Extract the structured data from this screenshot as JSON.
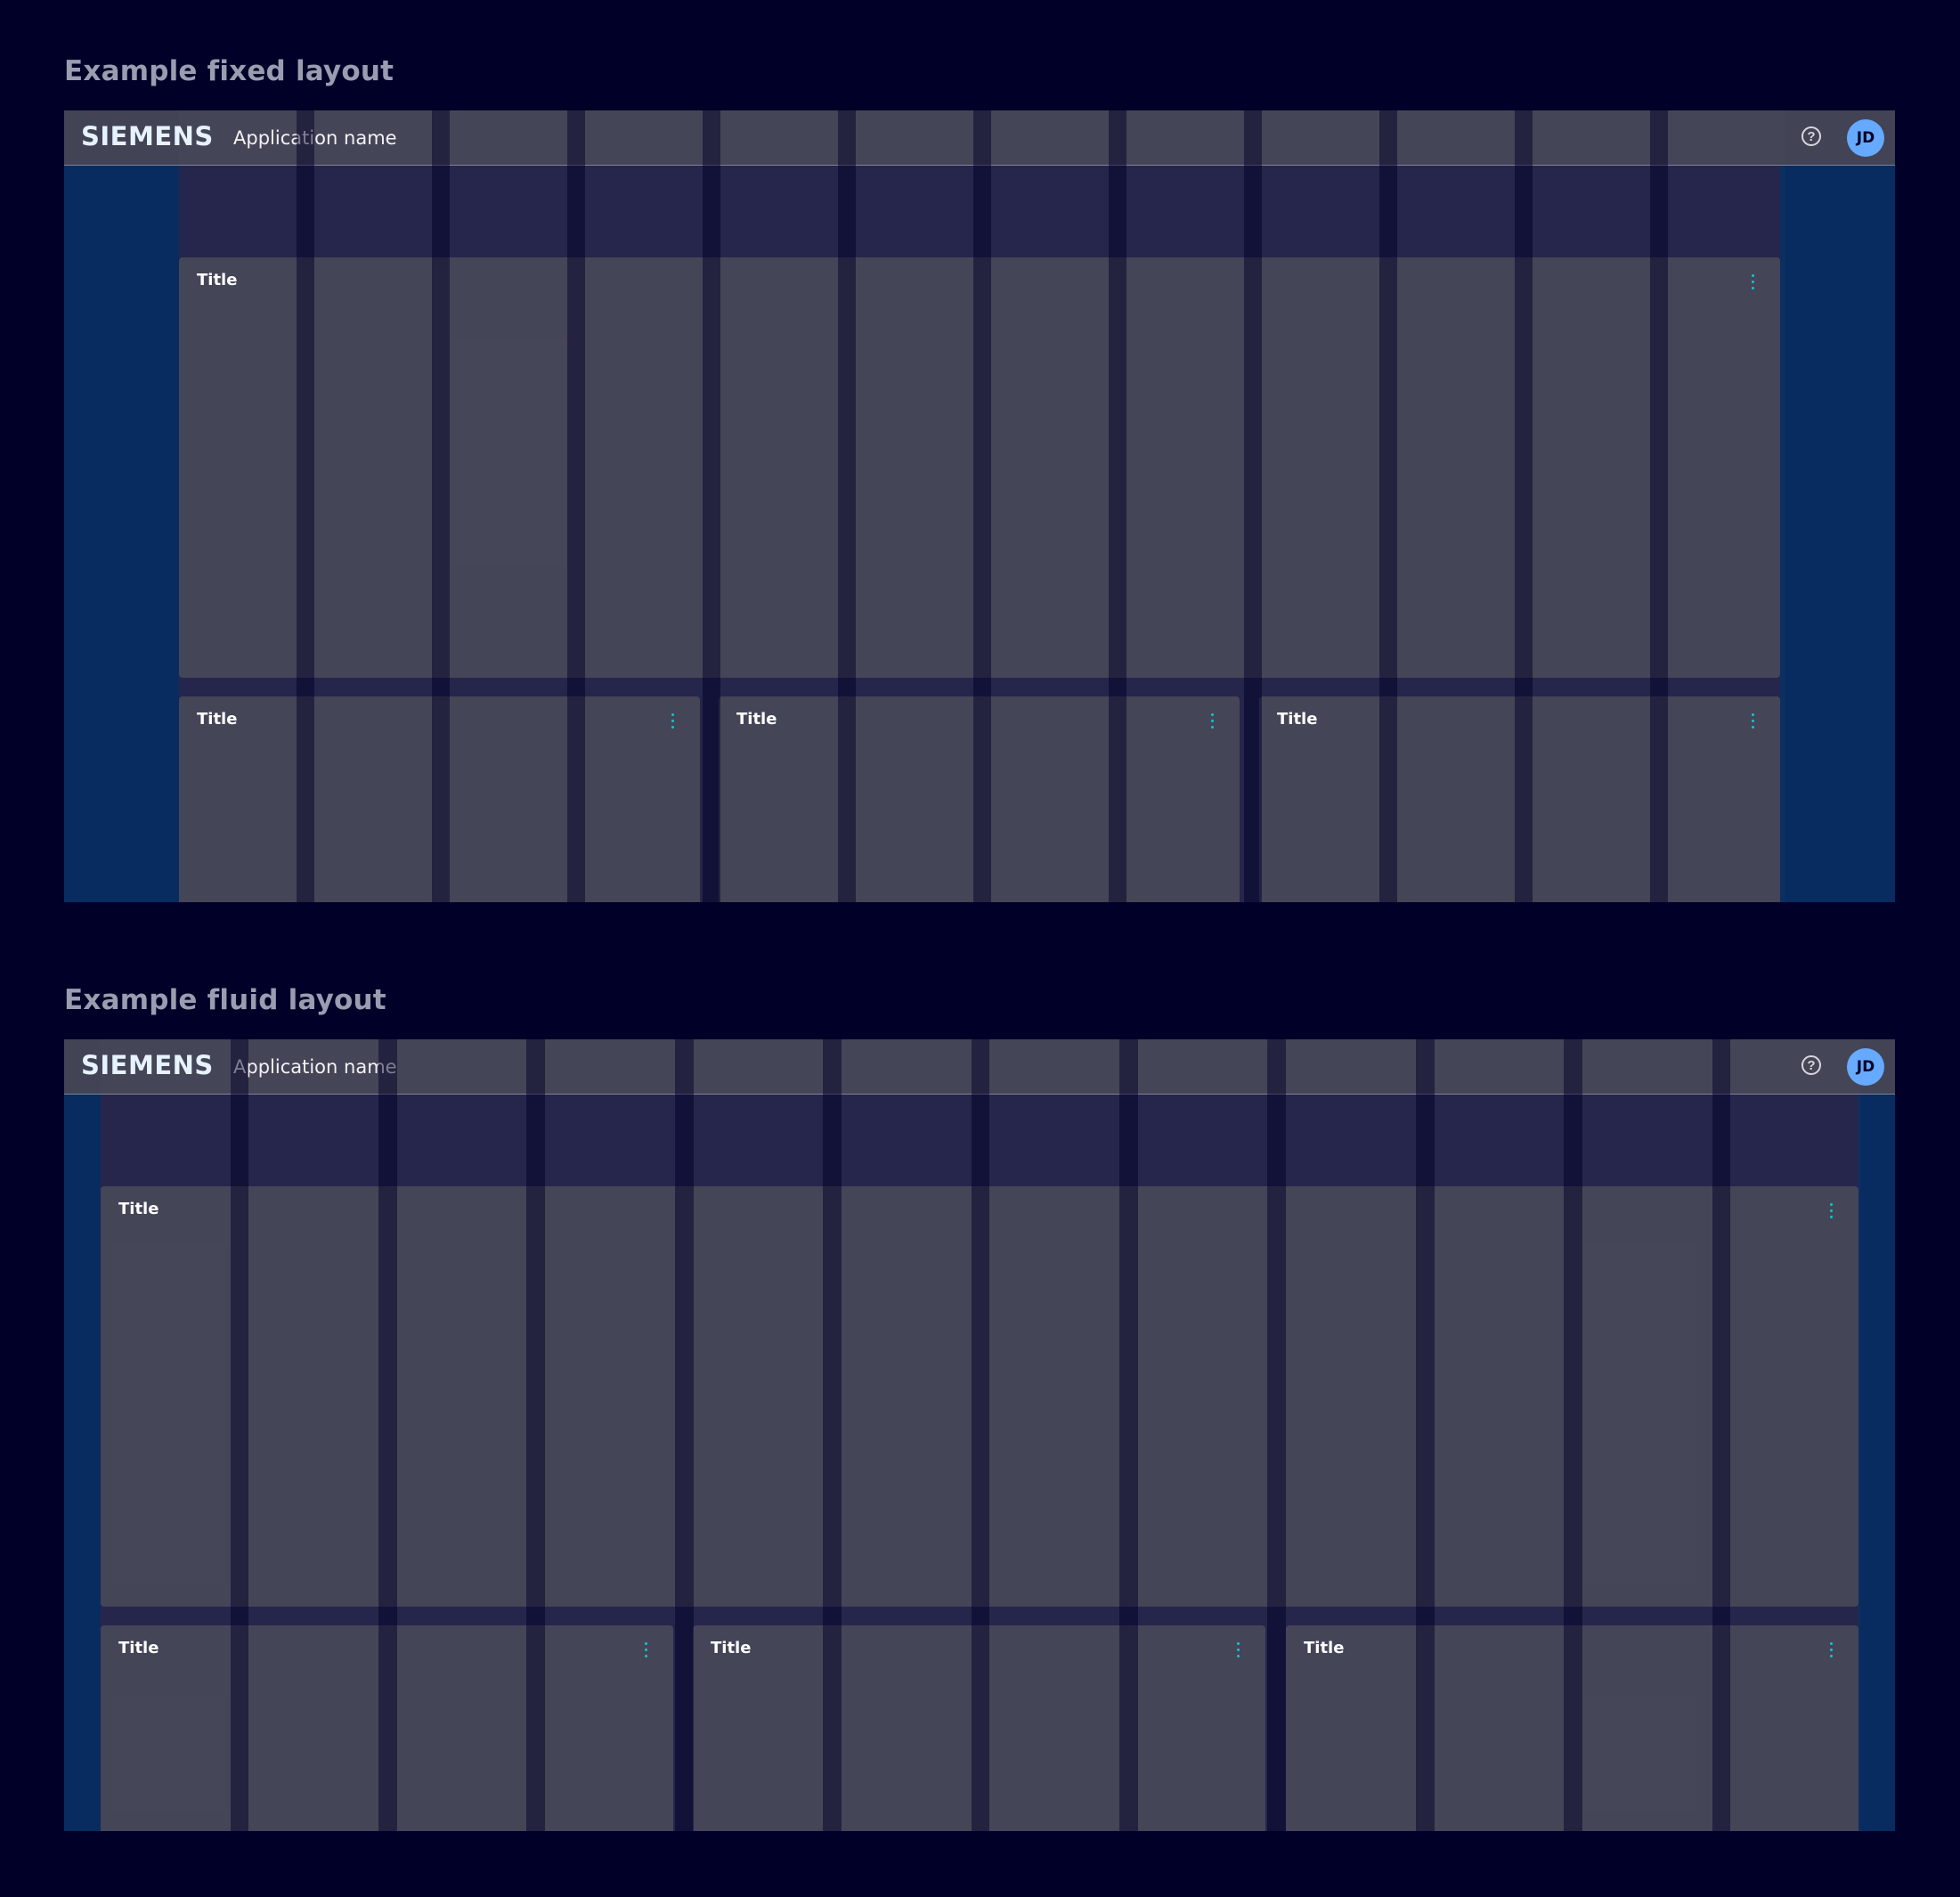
{
  "fixed": {
    "section_title": "Example fixed layout",
    "header": {
      "brand": "SIEMENS",
      "app_name": "Application name",
      "help_glyph": "?",
      "avatar_initials": "JD",
      "help_icon": "help-circle-icon"
    },
    "cards": [
      {
        "title": "Title",
        "menu_icon": "kebab-menu-icon"
      },
      {
        "title": "Title",
        "menu_icon": "kebab-menu-icon"
      },
      {
        "title": "Title",
        "menu_icon": "kebab-menu-icon"
      },
      {
        "title": "Title",
        "menu_icon": "kebab-menu-icon"
      }
    ]
  },
  "fluid": {
    "section_title": "Example fluid layout",
    "header": {
      "brand": "SIEMENS",
      "app_name": "Application name",
      "help_glyph": "?",
      "avatar_initials": "JD",
      "help_icon": "help-circle-icon"
    },
    "cards": [
      {
        "title": "Title",
        "menu_icon": "kebab-menu-icon"
      },
      {
        "title": "Title",
        "menu_icon": "kebab-menu-icon"
      },
      {
        "title": "Title",
        "menu_icon": "kebab-menu-icon"
      },
      {
        "title": "Title",
        "menu_icon": "kebab-menu-icon"
      }
    ]
  },
  "colors": {
    "page_bg": "#000028",
    "margin_bg": "#092c60",
    "content_bg": "#23234a",
    "card_bg": "#434356",
    "header_bg": "#434356",
    "accent_kebab": "#00cccc",
    "avatar_bg": "#66aaff"
  }
}
